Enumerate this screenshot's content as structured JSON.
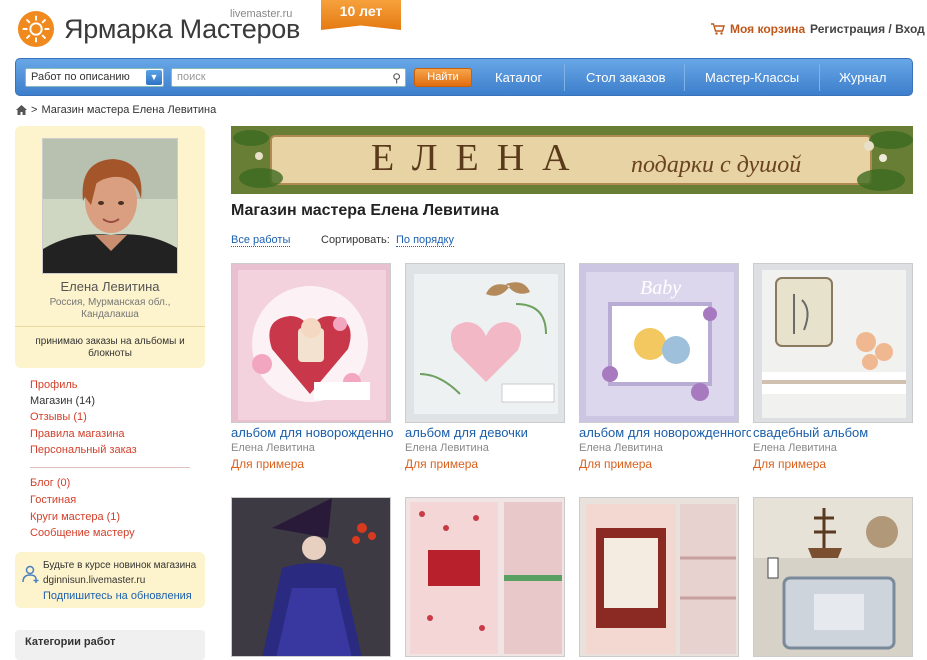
{
  "header": {
    "logo_text": "Ярмарка Мастеров",
    "logo_subtext": "livemaster.ru",
    "anniversary_badge": "10 лет",
    "cart_label": "Моя корзина",
    "auth_label": "Регистрация / Вход"
  },
  "search": {
    "type_selected": "Работ по описанию",
    "placeholder": "поиск",
    "find_button": "Найти"
  },
  "nav": {
    "items": [
      "Каталог",
      "Стол заказов",
      "Мастер-Классы",
      "Журнал"
    ]
  },
  "breadcrumb": {
    "separator": ">",
    "current": "Магазин мастера Елена Левитина"
  },
  "sidebar": {
    "master_name": "Елена Левитина",
    "location_line1": "Россия, Мурманская обл.,",
    "location_line2": "Кандалакша",
    "orders_line1": "принимаю заказы на альбомы и",
    "orders_line2": "блокноты",
    "links_primary": [
      "Профиль",
      "Магазин (14)",
      "Отзывы (1)",
      "Правила магазина",
      "Персональный заказ"
    ],
    "links_secondary": [
      "Блог (0)",
      "Гостиная",
      "Круги мастера (1)",
      "Сообщение мастеру"
    ],
    "subscribe_line1": "Будьте в курсе новинок магазина",
    "subscribe_line2": "dginnisun.livemaster.ru",
    "subscribe_link": "Подпишитесь на обновления",
    "categories_title": "Категории работ"
  },
  "banner": {
    "name": "ЕЛЕНА",
    "slogan": "подарки с душой"
  },
  "main": {
    "title": "Магазин мастера Елена Левитина",
    "all_works_link": "Все работы",
    "sort_label": "Сортировать:",
    "sort_value": "По порядку"
  },
  "products": [
    {
      "title": "альбом для новорожденного",
      "author": "Елена Левитина",
      "status": "Для примера"
    },
    {
      "title": "альбом для девочки",
      "author": "Елена Левитина",
      "status": "Для примера"
    },
    {
      "title": "альбом для новорожденного",
      "author": "Елена Левитина",
      "status": "Для примера"
    },
    {
      "title": "свадебный альбом",
      "author": "Елена Левитина",
      "status": "Для примера"
    }
  ],
  "colors": {
    "nav_blue": "#3d7ecc",
    "accent_orange": "#e57a12",
    "link_red": "#d23f2a",
    "link_blue": "#1b60b0",
    "sidebar_yellow": "#fdf3cc"
  },
  "icons": [
    "sun-logo-icon",
    "cart-icon",
    "chevron-down-icon",
    "search-icon",
    "home-icon",
    "user-plus-icon"
  ]
}
